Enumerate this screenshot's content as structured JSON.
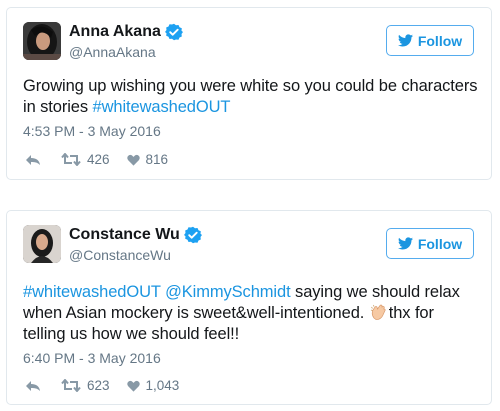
{
  "colors": {
    "link": "#1b95e0",
    "follow_border": "#55acee",
    "secondary_text": "#657786",
    "card_border": "#e1e8ed"
  },
  "tweets": [
    {
      "display_name": "Anna Akana",
      "handle": "@AnnaAkana",
      "follow_label": "Follow",
      "text_plain_1": "Growing up wishing you were white so you could be characters in stories ",
      "hashtag_1": "#whitewashedOUT",
      "timestamp": "4:53 PM - 3 May 2016",
      "retweets": "426",
      "likes": "816"
    },
    {
      "display_name": "Constance Wu",
      "handle": "@ConstanceWu",
      "follow_label": "Follow",
      "hashtag_1": "#whitewashedOUT",
      "mention_1": "@KimmySchmidt",
      "text_plain_1": " saying we should relax when Asian mockery is sweet&well-intentioned. ",
      "emoji_1": "clapping-hands",
      "text_plain_2": "thx for telling us how we should feel!!",
      "timestamp": "6:40 PM - 3 May 2016",
      "retweets": "623",
      "likes": "1,043"
    }
  ],
  "icons": {
    "verified": "verified-badge-icon",
    "follow": "twitter-bird-icon",
    "reply": "reply-arrow-icon",
    "retweet": "retweet-icon",
    "like": "heart-icon"
  }
}
